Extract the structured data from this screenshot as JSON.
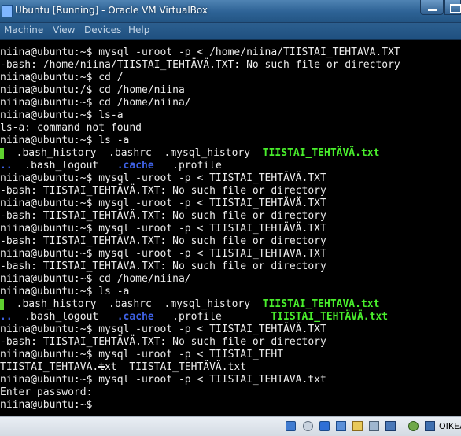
{
  "window": {
    "title": "Ubuntu [Running] - Oracle VM VirtualBox"
  },
  "menu": {
    "items": [
      "Machine",
      "View",
      "Devices",
      "Help"
    ]
  },
  "terminal": {
    "lines": [
      [
        {
          "t": "niina@ubuntu:~$ mysql -uroot -p < /home/niina/TIISTAI_TEHTÄVÄ.TXT"
        }
      ],
      [
        {
          "t": "-bash: /home/niina/TIISTAI_TEHTÄVÄ.TXT: No such file or directory"
        }
      ],
      [
        {
          "t": "niina@ubuntu:~$ cd /"
        }
      ],
      [
        {
          "t": "niina@ubuntu:/$ cd /home/niina"
        }
      ],
      [
        {
          "t": "niina@ubuntu:~$ cd /home/niina/"
        }
      ],
      [
        {
          "t": "niina@ubuntu:~$ ls-a"
        }
      ],
      [
        {
          "t": "ls-a: command not found"
        }
      ],
      [
        {
          "t": "niina@ubuntu:~$ ls -a"
        }
      ],
      [
        {
          "t": "",
          "s": "grnblk"
        },
        {
          "t": "  .bash_history  .bashrc  .mysql_history  "
        },
        {
          "t": "TIISTAI_TEHTÄVÄ.txt",
          "s": "green"
        }
      ],
      [
        {
          "t": "..",
          "s": "blue"
        },
        {
          "t": "  .bash_logout   "
        },
        {
          "t": ".cache",
          "s": "blue"
        },
        {
          "t": "   .profile"
        }
      ],
      [
        {
          "t": "niina@ubuntu:~$ mysql -uroot -p < TIISTAI_TEHTÄVÄ.TXT"
        }
      ],
      [
        {
          "t": "-bash: TIISTAI_TEHTÄVÄ.TXT: No such file or directory"
        }
      ],
      [
        {
          "t": "niina@ubuntu:~$ mysql -uroot -p < TIISTAI_TEHTÄVÄ.TXT"
        }
      ],
      [
        {
          "t": "-bash: TIISTAI_TEHTÄVÄ.TXT: No such file or directory"
        }
      ],
      [
        {
          "t": "niina@ubuntu:~$ mysql -uroot -p < TIISTAI_TEHTÄVÄ.TXT"
        }
      ],
      [
        {
          "t": "-bash: TIISTAI_TEHTÄVA.TXT: No such file or directory"
        }
      ],
      [
        {
          "t": "niina@ubuntu:~$ mysql -uroot -p < TIISTAI_TEHTAVA.TXT"
        }
      ],
      [
        {
          "t": "-bash: TIISTAI_TEHTAVA.TXT: No such file or directory"
        }
      ],
      [
        {
          "t": "niina@ubuntu:~$ cd /home/niina/"
        }
      ],
      [
        {
          "t": "niina@ubuntu:~$ ls -a"
        }
      ],
      [
        {
          "t": "",
          "s": "grnblk"
        },
        {
          "t": "  .bash_history  .bashrc  .mysql_history  "
        },
        {
          "t": "TIISTAI_TEHTAVA.txt",
          "s": "green"
        }
      ],
      [
        {
          "t": "..",
          "s": "blue"
        },
        {
          "t": "  .bash_logout   "
        },
        {
          "t": ".cache",
          "s": "blue"
        },
        {
          "t": "   .profile        "
        },
        {
          "t": "TIISTAI_TEHTÄVÄ.txt",
          "s": "green"
        }
      ],
      [
        {
          "t": "niina@ubuntu:~$ mysql -uroot -p < TIISTAI_TEHTÄVÄ.TXT"
        }
      ],
      [
        {
          "t": "-bash: TIISTAI_TEHTÄVÄ.TXT: No such file or directory"
        }
      ],
      [
        {
          "t": "niina@ubuntu:~$ mysql -uroot -p < TIISTAI_TEHT"
        }
      ],
      [
        {
          "t": "TIISTAI_TEHTAVA.txt  TIISTAI_TEHTÄVÄ.txt"
        }
      ],
      [
        {
          "t": "niina@ubuntu:~$ mysql -uroot -p < TIISTAI_TEHTAVA.txt"
        }
      ],
      [
        {
          "t": "Enter password:"
        }
      ],
      [
        {
          "t": "niina@ubuntu:~$ "
        }
      ]
    ]
  },
  "statusbar": {
    "icons": [
      "hard-disk-icon",
      "optical-drive-icon",
      "usb-icon",
      "network-icon",
      "shared-folders-icon",
      "display-icon",
      "video-capture-icon",
      "cpu-icon",
      "mouse-integration-icon",
      "keyboard-icon"
    ],
    "host_key": "OIKEA"
  },
  "colors": {
    "titlebar": "#2d6295",
    "menubar": "#1f5080",
    "terminal_bg": "#000000",
    "terminal_fg": "#ececec",
    "green_file": "#49ee2c",
    "blue_dir": "#3f62e6"
  }
}
